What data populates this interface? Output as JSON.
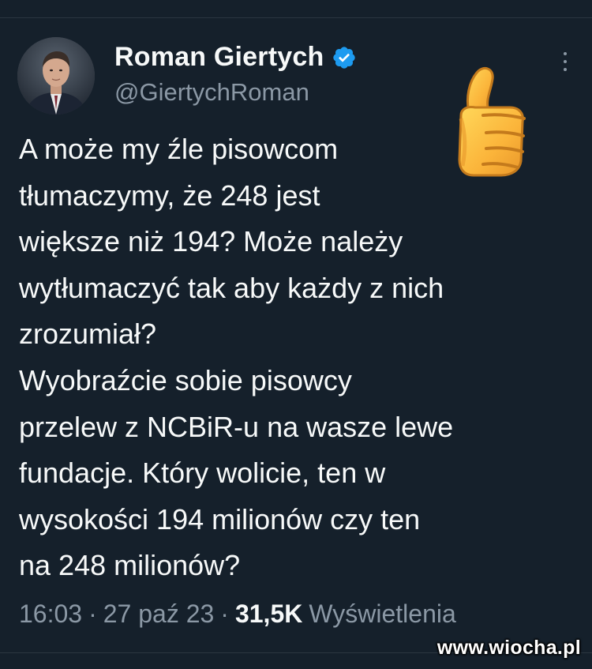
{
  "author": {
    "name": "Roman Giertych",
    "handle": "@GiertychRoman",
    "verified": true,
    "verified_color": "#1d9bf0"
  },
  "tweet": {
    "lines": [
      "A może my źle pisowcom",
      "tłumaczymy, że 248 jest",
      "większe niż 194? Może należy",
      "wytłumaczyć tak aby każdy z nich",
      "zrozumiał?",
      "Wyobraźcie sobie pisowcy",
      "przelew z NCBiR-u na wasze lewe",
      "fundacje. Który wolicie, ten w",
      "wysokości 194 milionów czy ten",
      "na 248 milionów?"
    ]
  },
  "meta": {
    "time": "16:03",
    "separator": "·",
    "date": "27 paź 23",
    "views_count": "31,5K",
    "views_label": "Wyświetlenia"
  },
  "decorations": {
    "emoji": "thumbs-up-icon"
  },
  "watermark": {
    "text": "www.wiocha.pl"
  },
  "colors": {
    "background": "#15202b",
    "text_primary": "#f7f9f9",
    "text_secondary": "#8b98a5"
  }
}
